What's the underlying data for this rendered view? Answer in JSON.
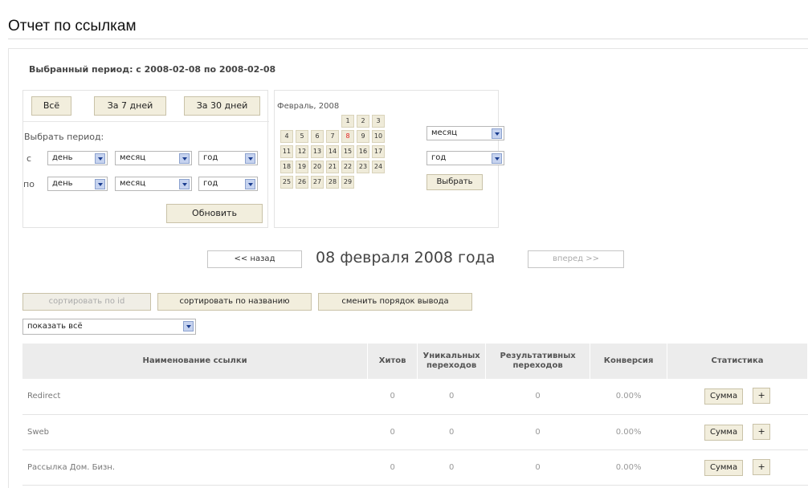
{
  "page": {
    "title": "Отчет по ссылкам"
  },
  "period": {
    "label": "Выбранный период: с 2008-02-08 по 2008-02-08"
  },
  "quick": {
    "all": "Всё",
    "week": "За 7 дней",
    "month": "За 30 дней"
  },
  "filter": {
    "choose_label": "Выбрать период:",
    "from_label": "с",
    "to_label": "по",
    "day": "день",
    "month": "месяц",
    "year": "год",
    "refresh": "Обновить"
  },
  "calendar": {
    "title": "Февраль, 2008",
    "days": [
      "1",
      "2",
      "3",
      "4",
      "5",
      "6",
      "7",
      "8",
      "9",
      "10",
      "11",
      "12",
      "13",
      "14",
      "15",
      "16",
      "17",
      "18",
      "19",
      "20",
      "21",
      "22",
      "23",
      "24",
      "25",
      "26",
      "27",
      "28",
      "29"
    ],
    "selected_day": "8",
    "month_select": "месяц",
    "year_select": "год",
    "choose": "Выбрать"
  },
  "nav": {
    "back": "<< назад",
    "date": "08 февраля 2008 года",
    "forward": "вперед >>"
  },
  "sort": {
    "by_id": "сортировать по id",
    "by_name": "сортировать по названию",
    "order": "сменить порядок вывода"
  },
  "show": {
    "value": "показать всё"
  },
  "table": {
    "headers": [
      "Наименование ссылки",
      "Хитов",
      "Уникальных переходов",
      "Результативных переходов",
      "Конверсия",
      "Статистика"
    ],
    "rows": [
      {
        "name": "Redirect",
        "hits": "0",
        "unique": "0",
        "effective": "0",
        "conversion": "0.00%"
      },
      {
        "name": "Sweb",
        "hits": "0",
        "unique": "0",
        "effective": "0",
        "conversion": "0.00%"
      },
      {
        "name": "Рассылка Дом. Бизн.",
        "hits": "0",
        "unique": "0",
        "effective": "0",
        "conversion": "0.00%"
      }
    ],
    "sum_label": "Сумма",
    "plus_label": "+"
  },
  "colors": {
    "button_bg": "#f2eedd",
    "header_bg": "#ececec",
    "selected_day": "#e02020"
  }
}
